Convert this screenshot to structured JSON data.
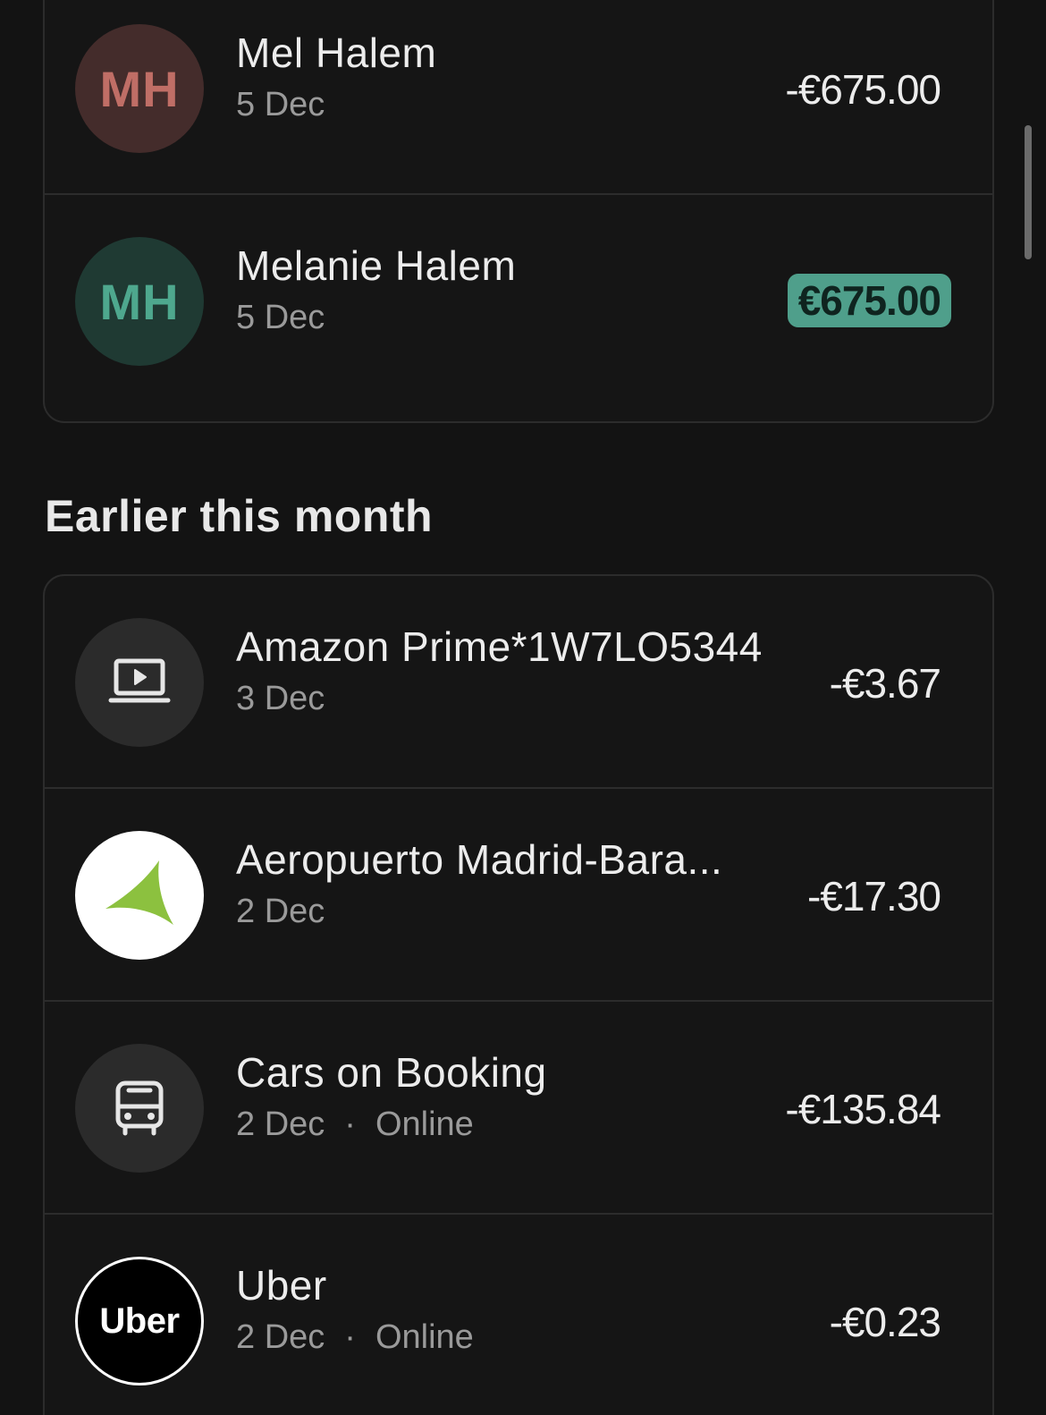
{
  "recent": [
    {
      "initials": "MH",
      "name": "Mel Halem",
      "date": "5 Dec",
      "amount": "-€675.00"
    },
    {
      "initials": "MH",
      "name": "Melanie Halem",
      "date": "5 Dec",
      "amount": "€675.00"
    }
  ],
  "section_title": "Earlier this month",
  "earlier": [
    {
      "name": "Amazon Prime*1W7LO5344",
      "date": "3 Dec",
      "amount": "-€3.67",
      "icon": "laptop-play-icon"
    },
    {
      "name": "Aeropuerto Madrid-Bara...",
      "date": "2 Dec",
      "amount": "-€17.30",
      "icon": "aena-logo-icon"
    },
    {
      "name": "Cars on Booking",
      "date": "2 Dec",
      "sep": "·",
      "channel": "Online",
      "amount": "-€135.84",
      "icon": "bus-icon"
    },
    {
      "name": "Uber",
      "date": "2 Dec",
      "sep": "·",
      "channel": "Online",
      "amount": "-€0.23",
      "icon": "uber-logo",
      "logo_text": "Uber"
    }
  ],
  "colors": {
    "background": "#131313",
    "positive_pill": "#4f9f8b",
    "avatar_red": "#442c2b",
    "avatar_green": "#1f3a33"
  }
}
